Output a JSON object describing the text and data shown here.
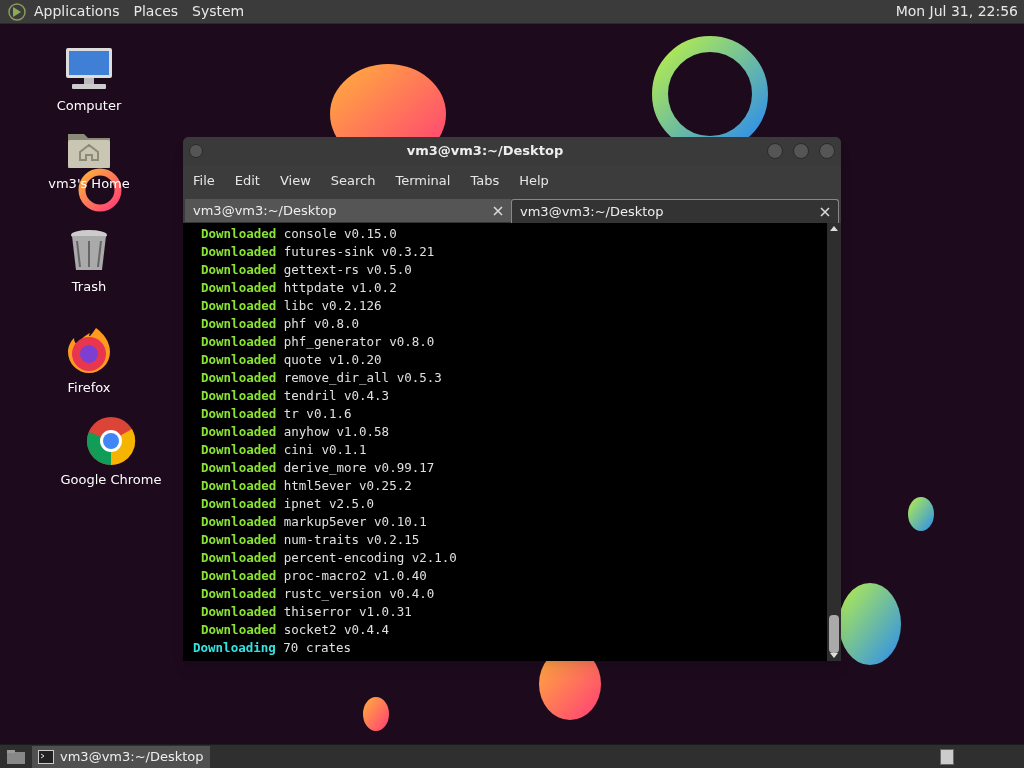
{
  "top_panel": {
    "menus": [
      "Applications",
      "Places",
      "System"
    ],
    "clock": "Mon Jul 31, 22:56"
  },
  "desktop_icons": [
    {
      "kind": "computer",
      "label": "Computer"
    },
    {
      "kind": "home",
      "label": "vm3's Home"
    },
    {
      "kind": "trash",
      "label": "Trash"
    },
    {
      "kind": "firefox",
      "label": "Firefox"
    },
    {
      "kind": "chrome",
      "label": "Google Chrome"
    }
  ],
  "terminal": {
    "title": "vm3@vm3:~/Desktop",
    "menu": [
      "File",
      "Edit",
      "View",
      "Search",
      "Terminal",
      "Tabs",
      "Help"
    ],
    "tabs": [
      {
        "label": "vm3@vm3:~/Desktop",
        "selected": false
      },
      {
        "label": "vm3@vm3:~/Desktop",
        "selected": true
      }
    ],
    "lines": [
      {
        "kind": "downloaded",
        "status": "Downloaded",
        "text": "console v0.15.0"
      },
      {
        "kind": "downloaded",
        "status": "Downloaded",
        "text": "futures-sink v0.3.21"
      },
      {
        "kind": "downloaded",
        "status": "Downloaded",
        "text": "gettext-rs v0.5.0"
      },
      {
        "kind": "downloaded",
        "status": "Downloaded",
        "text": "httpdate v1.0.2"
      },
      {
        "kind": "downloaded",
        "status": "Downloaded",
        "text": "libc v0.2.126"
      },
      {
        "kind": "downloaded",
        "status": "Downloaded",
        "text": "phf v0.8.0"
      },
      {
        "kind": "downloaded",
        "status": "Downloaded",
        "text": "phf_generator v0.8.0"
      },
      {
        "kind": "downloaded",
        "status": "Downloaded",
        "text": "quote v1.0.20"
      },
      {
        "kind": "downloaded",
        "status": "Downloaded",
        "text": "remove_dir_all v0.5.3"
      },
      {
        "kind": "downloaded",
        "status": "Downloaded",
        "text": "tendril v0.4.3"
      },
      {
        "kind": "downloaded",
        "status": "Downloaded",
        "text": "tr v0.1.6"
      },
      {
        "kind": "downloaded",
        "status": "Downloaded",
        "text": "anyhow v1.0.58"
      },
      {
        "kind": "downloaded",
        "status": "Downloaded",
        "text": "cini v0.1.1"
      },
      {
        "kind": "downloaded",
        "status": "Downloaded",
        "text": "derive_more v0.99.17"
      },
      {
        "kind": "downloaded",
        "status": "Downloaded",
        "text": "html5ever v0.25.2"
      },
      {
        "kind": "downloaded",
        "status": "Downloaded",
        "text": "ipnet v2.5.0"
      },
      {
        "kind": "downloaded",
        "status": "Downloaded",
        "text": "markup5ever v0.10.1"
      },
      {
        "kind": "downloaded",
        "status": "Downloaded",
        "text": "num-traits v0.2.15"
      },
      {
        "kind": "downloaded",
        "status": "Downloaded",
        "text": "percent-encoding v2.1.0"
      },
      {
        "kind": "downloaded",
        "status": "Downloaded",
        "text": "proc-macro2 v1.0.40"
      },
      {
        "kind": "downloaded",
        "status": "Downloaded",
        "text": "rustc_version v0.4.0"
      },
      {
        "kind": "downloaded",
        "status": "Downloaded",
        "text": "thiserror v1.0.31"
      },
      {
        "kind": "downloaded",
        "status": "Downloaded",
        "text": "socket2 v0.4.4"
      },
      {
        "kind": "downloading",
        "status": "Downloading",
        "text": "70 crates"
      }
    ]
  },
  "taskbar": {
    "tasks": [
      {
        "label": "vm3@vm3:~/Desktop",
        "selected": true
      }
    ]
  }
}
